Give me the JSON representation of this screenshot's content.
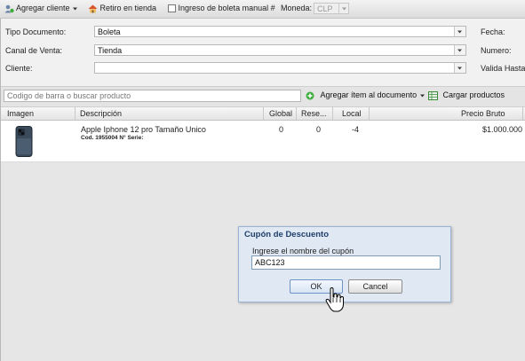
{
  "toolbar": {
    "add_client": "Agregar cliente",
    "store_pickup": "Retiro en tienda",
    "manual_receipt": "Ingreso de boleta manual #",
    "currency_label": "Moneda:",
    "currency_value": "CLP"
  },
  "form": {
    "doc_type_label": "Tipo Documento:",
    "doc_type_value": "Boleta",
    "channel_label": "Canal de Venta:",
    "channel_value": "Tienda",
    "client_label": "Cliente:",
    "client_value": "",
    "date_label": "Fecha:",
    "number_label": "Numero:",
    "valid_until_label": "Valida Hasta"
  },
  "search": {
    "placeholder": "Codigo de barra o buscar producto",
    "add_item": "Agregar ítem al documento",
    "load_products": "Cargar productos"
  },
  "grid": {
    "columns": [
      "Imagen",
      "Descripción",
      "Global",
      "Rese...",
      "Local",
      "Precio Bruto"
    ],
    "rows": [
      {
        "description": "Apple Iphone 12 pro Tamaño Unico",
        "code": "Cod. 1955004 N° Serie:",
        "global": "0",
        "reserved": "0",
        "local": "-4",
        "price": "$1.000.000"
      }
    ]
  },
  "dialog": {
    "title": "Cupón de Descuento",
    "prompt": "Ingrese el nombre del cupón",
    "value": "ABC123",
    "ok": "OK",
    "cancel": "Cancel"
  },
  "colors": {
    "dialog_title": "#1f3f6b",
    "dialog_bg": "#dfe8f3",
    "add_icon": "#3fae3f"
  }
}
